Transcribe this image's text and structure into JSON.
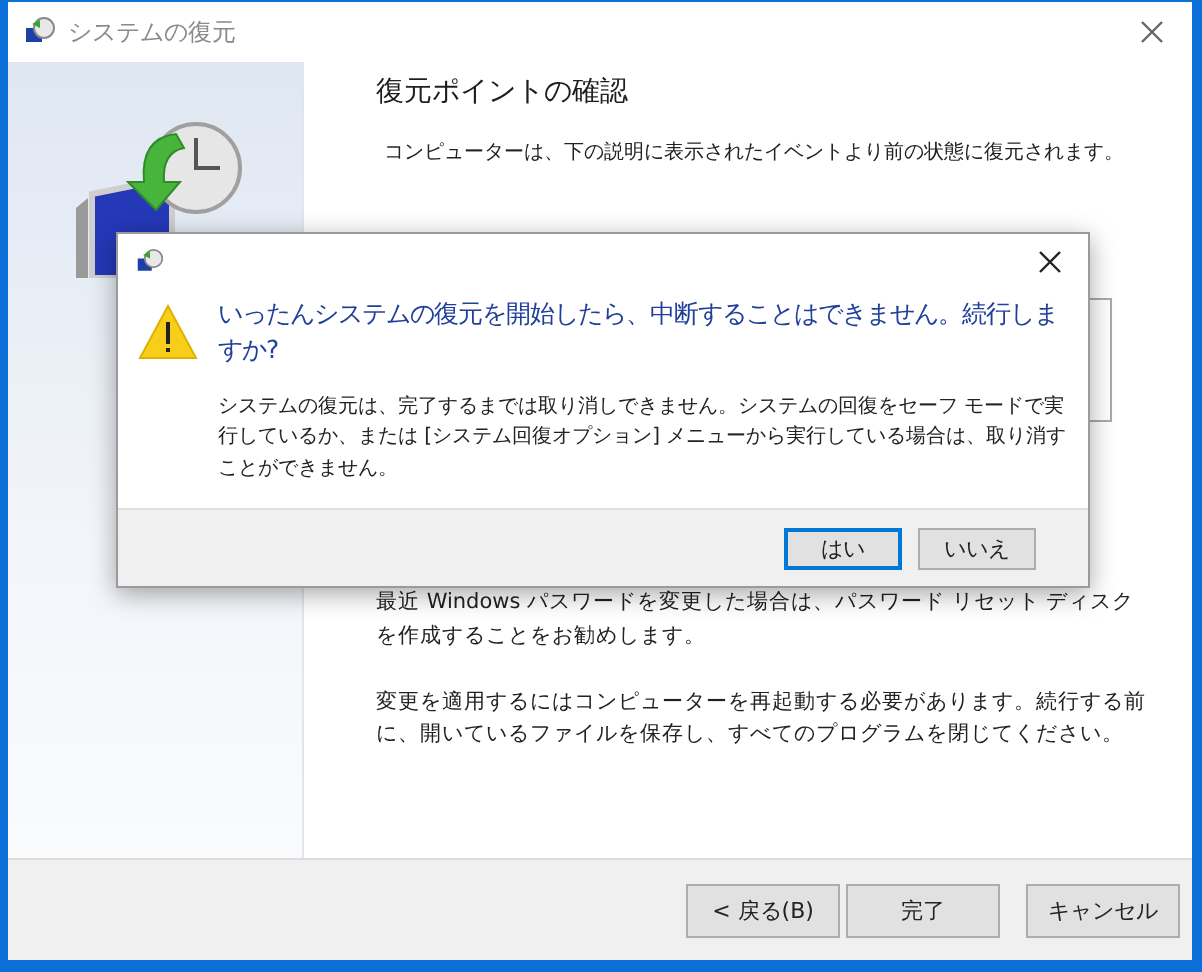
{
  "window": {
    "title": "システムの復元"
  },
  "page": {
    "heading": "復元ポイントの確認",
    "description": "コンピューターは、下の説明に表示されたイベントより前の状態に復元されます。",
    "notes": [
      "最近 Windows パスワードを変更した場合は、パスワード リセット ディスクを作成することをお勧めします。",
      "変更を適用するにはコンピューターを再起動する必要があります。続行する前に、開いているファイルを保存し、すべてのプログラムを閉じてください。"
    ]
  },
  "buttons": [
    "< 戻る(B)",
    "完了",
    "キャンセル"
  ],
  "dialog": {
    "message": "いったんシステムの復元を開始したら、中断することはできません。続行しますか?",
    "detail": "システムの復元は、完了するまでは取り消しできません。システムの回復をセーフ モードで実行しているか、または [システム回復オプション] メニューから実行している場合は、取り消すことができません。",
    "buttons": [
      {
        "label": "はい",
        "default": true
      },
      {
        "label": "いいえ",
        "default": false
      }
    ]
  }
}
